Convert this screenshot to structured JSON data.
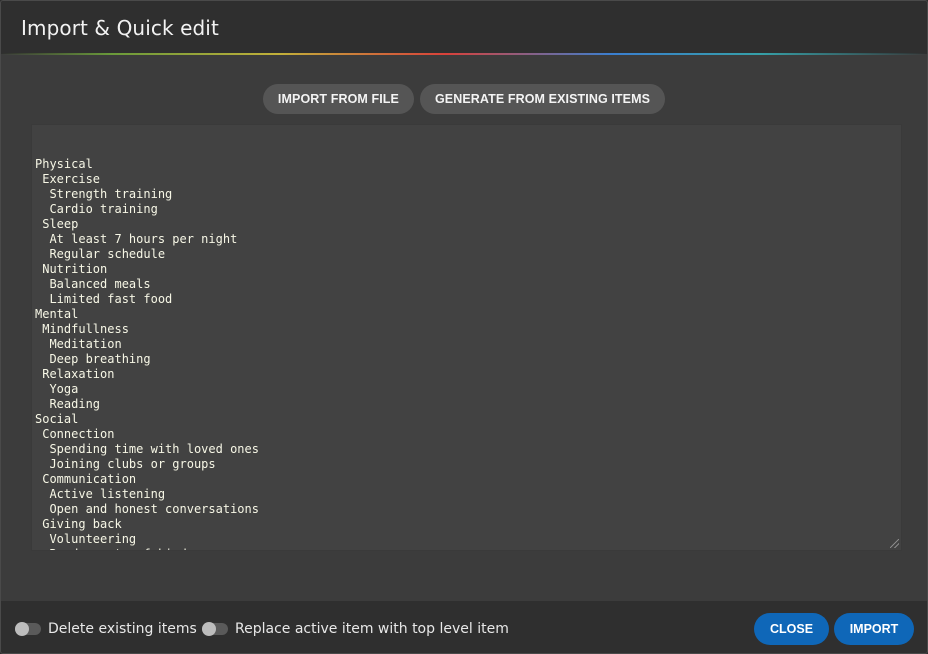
{
  "dialog": {
    "title": "Import & Quick edit"
  },
  "toolbar": {
    "import_from_file": "IMPORT FROM FILE",
    "generate_from_existing": "GENERATE FROM EXISTING ITEMS"
  },
  "editor": {
    "lines": [
      "Physical",
      " Exercise",
      "  Strength training",
      "  Cardio training",
      " Sleep",
      "  At least 7 hours per night",
      "  Regular schedule",
      " Nutrition",
      "  Balanced meals",
      "  Limited fast food",
      "Mental",
      " Mindfullness",
      "  Meditation",
      "  Deep breathing",
      " Relaxation",
      "  Yoga",
      "  Reading",
      "Social",
      " Connection",
      "  Spending time with loved ones",
      "  Joining clubs or groups",
      " Communication",
      "  Active listening",
      "  Open and honest conversations",
      " Giving back",
      "  Volunteering",
      "  Random acts of kindness"
    ]
  },
  "footer": {
    "delete_existing_label": "Delete existing items",
    "delete_existing_on": false,
    "replace_active_label": "Replace active item with top level item",
    "replace_active_on": false,
    "close_label": "CLOSE",
    "import_label": "IMPORT"
  },
  "colors": {
    "primary": "#0f67b8",
    "editor_text": "#f7f7e6",
    "pill_bg": "#555555"
  }
}
